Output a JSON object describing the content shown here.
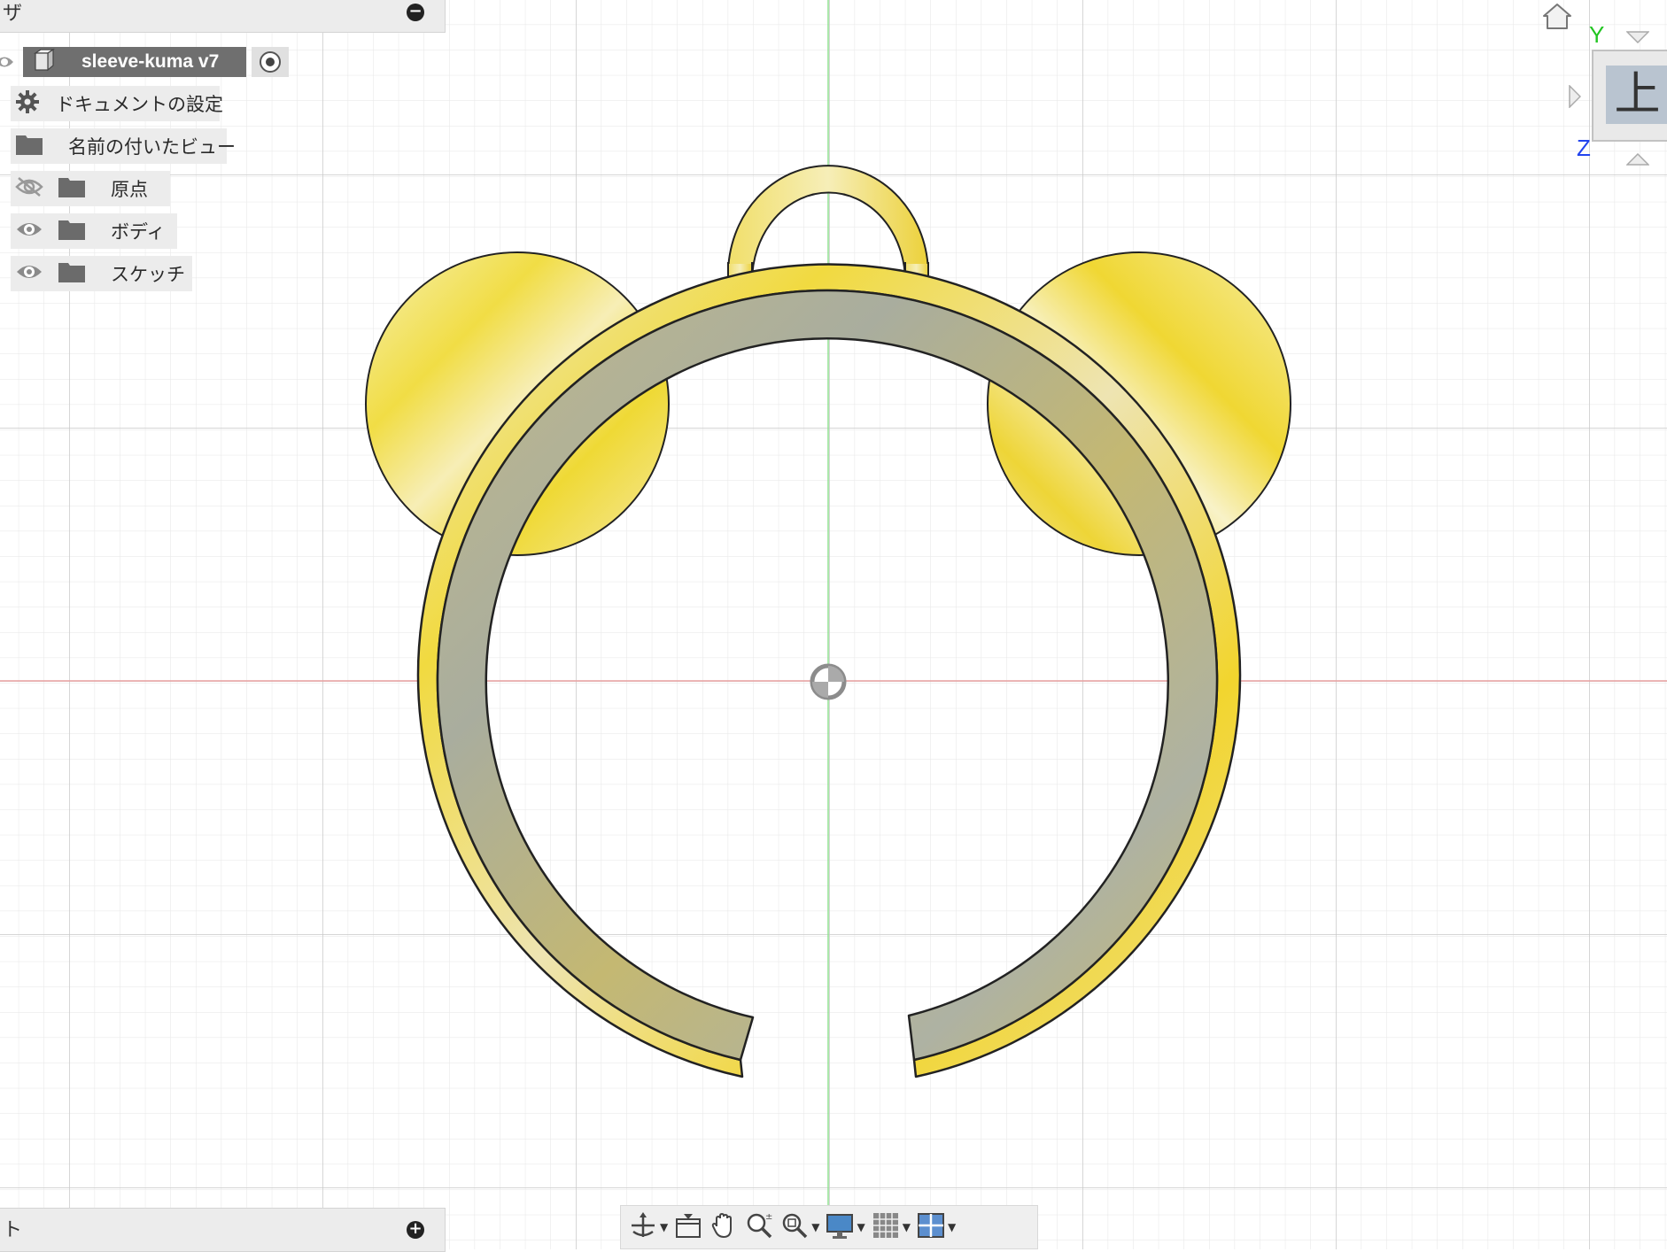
{
  "browser": {
    "title_fragment": "ザ",
    "document_name": "sleeve-kuma v7",
    "items": [
      {
        "label": "ドキュメントの設定",
        "icon": "gear-icon"
      },
      {
        "label": "名前の付いたビュー",
        "icon": "folder-icon"
      },
      {
        "label": "原点",
        "icon": "folder-icon",
        "visibility": "hidden"
      },
      {
        "label": "ボディ",
        "icon": "folder-icon",
        "visibility": "visible"
      },
      {
        "label": "スケッチ",
        "icon": "folder-icon",
        "visibility": "visible"
      }
    ]
  },
  "comments": {
    "title_fragment": "ト"
  },
  "viewcube": {
    "face_label": "上",
    "axis_y": "Y",
    "axis_z": "Z"
  },
  "colors": {
    "x_axis": "#e8a0a0",
    "y_axis": "#90e090",
    "axis_y_label": "#22c522",
    "axis_z_label": "#2244ee",
    "model_yellow": "#f2dc4a",
    "band_gray": "#b5b29a"
  },
  "toolbar": {
    "buttons": [
      "orbit-icon",
      "look-at-icon",
      "pan-icon",
      "zoom-icon",
      "fit-icon",
      "display-settings-icon",
      "grid-icon",
      "viewports-icon"
    ]
  }
}
